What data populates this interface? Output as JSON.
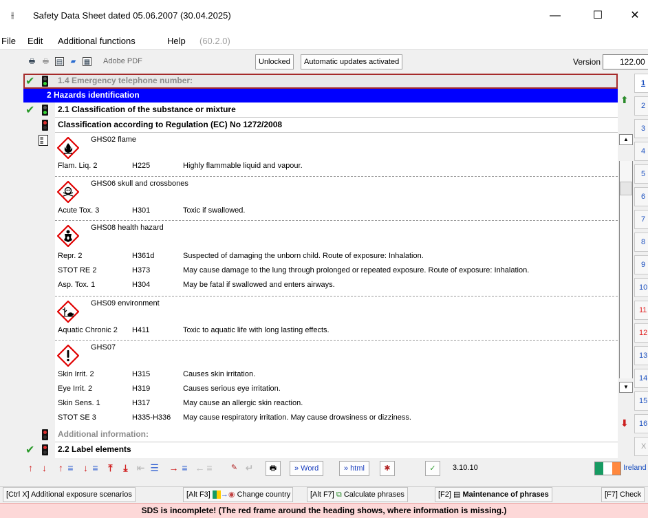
{
  "window": {
    "title": "Safety Data Sheet dated 05.06.2007 (30.04.2025)",
    "minimize": "—",
    "maximize": "☐",
    "close": "✕"
  },
  "menu": {
    "file": "File",
    "edit": "Edit",
    "additional": "Additional functions",
    "help": "Help",
    "build": "(60.2.0)"
  },
  "toolbar": {
    "adobe_label": "Adobe PDF",
    "unlocked": "Unlocked",
    "auto_updates": "Automatic updates activated",
    "version_label": "Version",
    "version_value": "122.00"
  },
  "sections": {
    "emergency": "1.4 Emergency telephone number:",
    "hazards": "2 Hazards identification",
    "classification": "2.1 Classification of the substance or mixture",
    "regulation": "Classification according to Regulation (EC) No 1272/2008",
    "additional": "Additional information:",
    "label_elements": "2.2 Label elements"
  },
  "pictograms": [
    {
      "name": "GHS02 flame",
      "icon": "flame-icon",
      "hazards": [
        {
          "class": "Flam. Liq. 2",
          "code": "H225",
          "text": "Highly flammable liquid and vapour."
        }
      ]
    },
    {
      "name": "GHS06 skull and crossbones",
      "icon": "skull-icon",
      "hazards": [
        {
          "class": "Acute Tox. 3",
          "code": "H301",
          "text": "Toxic if swallowed."
        }
      ]
    },
    {
      "name": "GHS08 health hazard",
      "icon": "health-hazard-icon",
      "hazards": [
        {
          "class": "Repr. 2",
          "code": "H361d",
          "text": "Suspected of damaging the unborn child. Route of exposure: Inhalation."
        },
        {
          "class": "STOT RE 2",
          "code": "H373",
          "text": "May cause damage to the lung through prolonged or repeated exposure. Route of exposure: Inhalation."
        },
        {
          "class": "Asp. Tox. 1",
          "code": "H304",
          "text": "May be fatal if swallowed and enters airways."
        }
      ]
    },
    {
      "name": "GHS09 environment",
      "icon": "environment-icon",
      "hazards": [
        {
          "class": "Aquatic Chronic 2",
          "code": "H411",
          "text": "Toxic to aquatic life with long lasting effects."
        }
      ]
    },
    {
      "name": "GHS07",
      "icon": "exclamation-icon",
      "hazards": [
        {
          "class": "Skin Irrit. 2",
          "code": "H315",
          "text": "Causes skin irritation."
        },
        {
          "class": "Eye Irrit. 2",
          "code": "H319",
          "text": "Causes serious eye irritation."
        },
        {
          "class": "Skin Sens. 1",
          "code": "H317",
          "text": "May cause an allergic skin reaction."
        },
        {
          "class": "STOT SE 3",
          "code": "H335-H336",
          "text": "May cause respiratory irritation. May cause drowsiness or dizziness."
        }
      ]
    }
  ],
  "pages": [
    "1",
    "2",
    "3",
    "4",
    "5",
    "6",
    "7",
    "8",
    "9",
    "10",
    "11",
    "12",
    "13",
    "14",
    "15",
    "16",
    "X"
  ],
  "navbar": {
    "word": "» Word",
    "html": "» html",
    "version": "3.10.10",
    "country": "Ireland"
  },
  "hotkeys": {
    "k1": "[Ctrl X] Additional exposure scenarios",
    "k2_key": "[Alt F3]",
    "k2_label": "Change country",
    "k3_key": "[Alt F7]",
    "k3_label": "Calculate phrases",
    "k4_key": "[F2]",
    "k4_label": "Maintenance of phrases",
    "k5": "[F7] Check"
  },
  "status": "SDS is incomplete! (The red frame around the heading shows, where information is missing.)",
  "colors": {
    "selected_row": "#0000ff",
    "missing_frame": "#a52a2a",
    "status_bg": "#fdd8d8",
    "ghs_red": "#e00000"
  }
}
